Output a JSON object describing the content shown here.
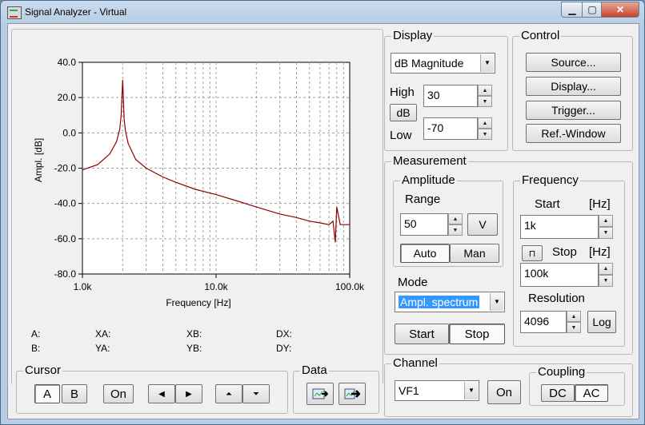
{
  "window": {
    "title": "Signal Analyzer - Virtual"
  },
  "chart_data": {
    "type": "line",
    "xlabel": "Frequency [Hz]",
    "ylabel": "Ampl. [dB]",
    "xscale": "log",
    "xlim": [
      1000,
      100000
    ],
    "ylim": [
      -80,
      40
    ],
    "grid": true,
    "x_tick_labels": [
      "1.0k",
      "10.0k",
      "100.0k"
    ],
    "y_tick_labels": [
      "40.0",
      "20.0",
      "0.0",
      "-20.0",
      "-40.0",
      "-60.0",
      "-80.0"
    ],
    "series": [
      {
        "color": "#8b0000",
        "x": [
          1000,
          1300,
          1600,
          1800,
          1900,
          1950,
          2000,
          2050,
          2100,
          2200,
          2500,
          3000,
          4000,
          5000,
          7000,
          10000,
          15000,
          20000,
          30000,
          40000,
          50000,
          60000,
          70000,
          75000,
          78000,
          80000,
          85000,
          90000,
          100000
        ],
        "y": [
          -21,
          -18,
          -12,
          -5,
          2,
          10,
          30,
          8,
          1,
          -6,
          -15,
          -20,
          -25,
          -28,
          -32,
          -35,
          -39,
          -42,
          -46,
          -48,
          -50,
          -51,
          -52,
          -50,
          -62,
          -42,
          -52,
          -52,
          -52
        ]
      }
    ]
  },
  "readouts": {
    "A": "A:",
    "B": "B:",
    "XA": "XA:",
    "YA": "YA:",
    "XB": "XB:",
    "YB": "YB:",
    "DX": "DX:",
    "DY": "DY:"
  },
  "display": {
    "legend": "Display",
    "mode": "dB Magnitude",
    "high_label": "High",
    "high_value": "30",
    "low_label": "Low",
    "low_value": "-70",
    "unit_button": "dB"
  },
  "control": {
    "legend": "Control",
    "source": "Source...",
    "display": "Display...",
    "trigger": "Trigger...",
    "ref_window": "Ref.-Window"
  },
  "measurement": {
    "legend": "Measurement",
    "amplitude": {
      "legend": "Amplitude",
      "range_label": "Range",
      "range_value": "50",
      "unit": "V",
      "auto": "Auto",
      "man": "Man"
    },
    "mode_label": "Mode",
    "mode_value": "Ampl. spectrum",
    "start": "Start",
    "stop": "Stop",
    "frequency": {
      "legend": "Frequency",
      "start_label": "Start",
      "start_unit": "[Hz]",
      "start_value": "1k",
      "stop_label": "Stop",
      "stop_unit": "[Hz]",
      "stop_value": "100k",
      "resolution_label": "Resolution",
      "resolution_value": "4096",
      "log": "Log"
    }
  },
  "cursor": {
    "legend": "Cursor",
    "a": "A",
    "b": "B",
    "on": "On"
  },
  "data_group": {
    "legend": "Data"
  },
  "channel": {
    "legend": "Channel",
    "value": "VF1",
    "on": "On"
  },
  "coupling": {
    "legend": "Coupling",
    "dc": "DC",
    "ac": "AC"
  }
}
